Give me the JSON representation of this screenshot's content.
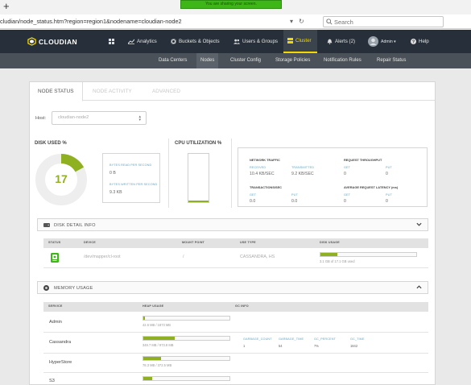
{
  "browser": {
    "new_tab": "+",
    "sharing_banner": "You are sharing your screen.",
    "url": "cludian/node_status.htm?region=region1&nodename=cloudian-node2",
    "dropdown_glyph": "▾",
    "reload_glyph": "↻",
    "search_placeholder": "Search"
  },
  "app": {
    "logo_text": "CLOUDIAN",
    "nav": [
      {
        "label": "Analytics",
        "icon": "chart-icon"
      },
      {
        "label": "Buckets & Objects",
        "icon": "gear-icon"
      },
      {
        "label": "Users & Groups",
        "icon": "users-icon"
      },
      {
        "label": "Cluster",
        "icon": "cluster-icon",
        "active": true
      },
      {
        "label": "Alerts (2)",
        "icon": "bell-icon"
      },
      {
        "label": "Admin ▾",
        "icon": "avatar"
      },
      {
        "label": "Help",
        "icon": "help-icon"
      }
    ],
    "subnav": [
      "Data Centers",
      "Nodes",
      "Cluster Config",
      "Storage Policies",
      "Notification Rules",
      "Repair Status"
    ],
    "subnav_active": "Nodes",
    "accent_color": "#f5d800",
    "bar_color": "#8fb020"
  },
  "tabs": [
    "NODE STATUS",
    "NODE ACTIVITY",
    "ADVANCED"
  ],
  "host": {
    "label": "Host:",
    "value": "cloudian-node2"
  },
  "disk_used": {
    "title": "DISK USED %",
    "percent": 17,
    "bytes_read_label": "BYTES READ PER SECOND",
    "bytes_read_value": "0 B",
    "bytes_written_label": "BYTES WRITTEN PER SECOND",
    "bytes_written_value": "9.3 KB"
  },
  "cpu": {
    "title": "CPU UTILIZATION %",
    "percent": 3
  },
  "network": {
    "title": "NETWORK TRAFFIC",
    "received_label": "RECEIVED",
    "received_value": "10.4 KB/SEC",
    "transmitted_label": "TRANSMITTED",
    "transmitted_value": "9.2 KB/SEC"
  },
  "request_throughput": {
    "title": "REQUEST THROUGHPUT",
    "get_label": "GET",
    "get_value": "0",
    "put_label": "PUT",
    "put_value": "0"
  },
  "transactions": {
    "title": "TRANSACTIONS/SEC",
    "get_label": "GET",
    "get_value": "0.0",
    "put_label": "PUT",
    "put_value": "0.0"
  },
  "latency": {
    "title": "AVERAGE REQUEST LATENCY (ms)",
    "get_label": "GET",
    "get_value": "0",
    "put_label": "PUT",
    "put_value": "0"
  },
  "disk_detail": {
    "title": "DISK DETAIL INFO",
    "columns": [
      "STATUS",
      "DEVICE",
      "MOUNT POINT",
      "USE TYPE",
      "DISK USAGE"
    ],
    "rows": [
      {
        "device": "/dev/mapper/cl-root",
        "mount": "/",
        "use_type": "CASSANDRA, HS",
        "usage_text": "3.1 GB of 17.1 GB used",
        "usage_fraction": 0.18
      }
    ]
  },
  "memory": {
    "title": "MEMORY USAGE",
    "columns": [
      "SERVICE",
      "HEAP USAGE",
      "GC INFO"
    ],
    "rows": [
      {
        "service": "Admin",
        "heap": "42.6 MB / 1873 MB",
        "fraction": 0.02
      },
      {
        "service": "Cassandra",
        "heap": "349.7 MB / 973.8 MB",
        "fraction": 0.36
      },
      {
        "service": "HyperStore",
        "heap": "78.3 MB / 372.5 MB",
        "fraction": 0.21
      },
      {
        "service": "S3",
        "heap": "",
        "fraction": 0.1
      }
    ],
    "gc": {
      "labels": [
        "GARBAGE_COUNT",
        "GARBAGE_TIME",
        "GC_PERCENT",
        "GC_TIME"
      ],
      "values": [
        "1",
        "54",
        "7%",
        "1842"
      ]
    }
  }
}
